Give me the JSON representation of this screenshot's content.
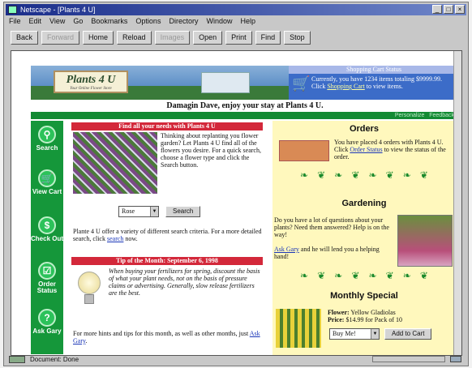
{
  "window": {
    "title": "Netscape - [Plants 4 U]"
  },
  "menu": [
    "File",
    "Edit",
    "View",
    "Go",
    "Bookmarks",
    "Options",
    "Directory",
    "Window",
    "Help"
  ],
  "toolbar": {
    "back": "Back",
    "forward": "Forward",
    "home": "Home",
    "reload": "Reload",
    "images": "Images",
    "open": "Open",
    "print": "Print",
    "find": "Find",
    "stop": "Stop"
  },
  "banner": {
    "logo": "Plants 4 U",
    "logo_tagline": "Your Online Flower Store",
    "cart": {
      "title": "Shopping Cart Status",
      "text_prefix": "Currently, you have 1234 items totaling $9999.99. Click ",
      "link": "Shopping Cart",
      "text_suffix": " to view items."
    }
  },
  "welcome": "Damagin Dave, enjoy your stay at Plants 4 U.",
  "greenbar": {
    "links": [
      "Personalize",
      "Feedback"
    ]
  },
  "nav": [
    {
      "label": "Search",
      "icon": "search-icon",
      "glyph": "⚲"
    },
    {
      "label": "View Cart",
      "icon": "cart-icon",
      "glyph": "🛒"
    },
    {
      "label": "Check Out",
      "icon": "dollar-icon",
      "glyph": "$"
    },
    {
      "label": "Order Status",
      "icon": "checkbox-icon",
      "glyph": "☑"
    },
    {
      "label": "Ask Gary",
      "icon": "question-icon",
      "glyph": "?"
    }
  ],
  "find": {
    "header": "Find all your needs with Plants 4 U",
    "intro": "Thinking about replanting you flower garden? Let Plants 4 U find all of the flowers you desire. For a quick search, choose a flower type and click the Search button.",
    "select_value": "Rose",
    "search_button": "Search",
    "variety_prefix": "Plante 4 U offer a variety of different search criteria. For a more detailed search, click ",
    "variety_link": "search",
    "variety_suffix": " now."
  },
  "tip": {
    "header": "Tip of the Month: September 6, 1998",
    "text": "When buying your fertilizers for spring, discount the basis of what your plant needs, not on the basis of pressure claims or advertising. Generally, slow release fertilizers are the best.",
    "more_prefix": "For more hints and tips for this month, as well as other months, just ",
    "more_link": "Ask Gary",
    "more_suffix": "."
  },
  "orders": {
    "title": "Orders",
    "text_prefix": "You have placed 4 orders with Plants 4 U. Click ",
    "link": "Order Status",
    "text_suffix": " to view the status of the order."
  },
  "gardening": {
    "title": "Gardening",
    "text": "Do you have a lot of questions about your plants? Need them answered? Help is on the way!",
    "link": "Ask Gary",
    "link_suffix": " and he will lend you a helping hand!"
  },
  "special": {
    "title": "Monthly Special",
    "flower_label": "Flower:",
    "flower": "Yellow Gladiolas",
    "price_label": "Price:",
    "price": "$14.99 for Pack of 10",
    "buy_select": "Buy Me!",
    "add_button": "Add to Cart"
  },
  "status": {
    "text": "Document: Done"
  }
}
